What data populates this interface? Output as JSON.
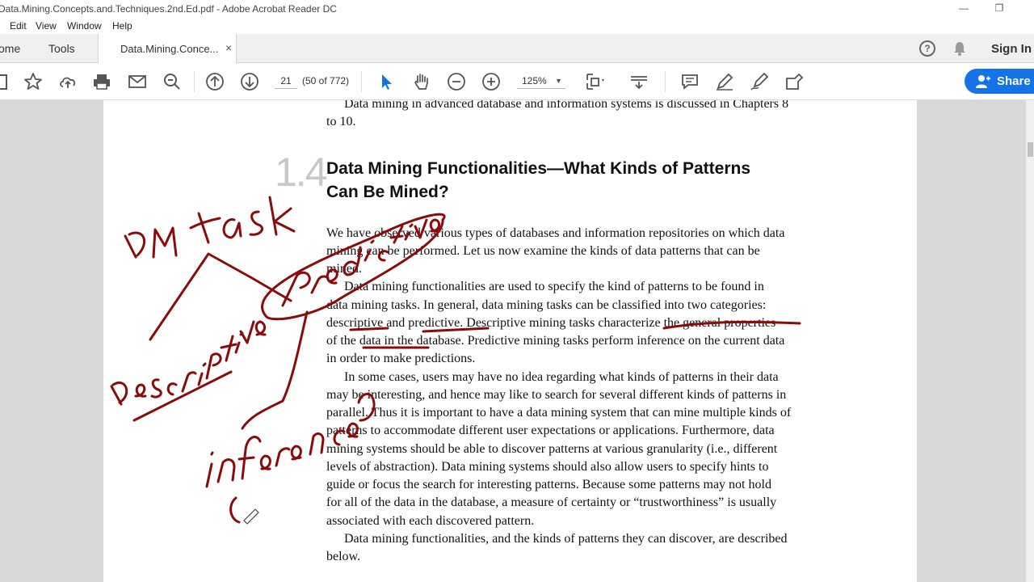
{
  "window": {
    "title": "Data.Mining.Concepts.and.Techniques.2nd.Ed.pdf - Adobe Acrobat Reader DC",
    "minimize": "—",
    "restore": "❐"
  },
  "menu": [
    "Edit",
    "View",
    "Window",
    "Help"
  ],
  "tabs": {
    "home": "ome",
    "tools": "Tools",
    "document": "Data.Mining.Conce...",
    "close": "×",
    "sign_in": "Sign In"
  },
  "toolbar": {
    "page_current": "21",
    "page_of": "(50 of 772)",
    "zoom": "125%",
    "share": "Share"
  },
  "document": {
    "intro_lines": [
      "Data mining in advanced database and information systems is discussed in Chapters 8",
      "to 10."
    ],
    "section_number": "1.4",
    "heading_lines": [
      "Data Mining Functionalities—What Kinds of Patterns",
      "Can Be Mined?"
    ],
    "body_lines": [
      "We have observed various types of databases and information repositories on which data",
      "mining can be performed. Let us now examine the kinds of data patterns that can be",
      "mined.",
      "Data mining functionalities are used to specify the kind of patterns to be found in",
      "data mining tasks. In general, data mining tasks can be classified into two categories:",
      "descriptive and predictive. Descriptive mining tasks characterize the general properties",
      "of the data in the database. Predictive mining tasks perform inference on the current data",
      "in order to make predictions.",
      "In some cases, users may have no idea regarding what kinds of patterns in their data",
      "may be interesting, and hence may like to search for several different kinds of patterns in",
      "parallel. Thus it is important to have a data mining system that can mine multiple kinds of",
      "patterns to accommodate different user expectations or applications. Furthermore, data",
      "mining systems should be able to discover patterns at various granularity (i.e., different",
      "levels of abstraction). Data mining systems should also allow users to specify hints to",
      "guide or focus the search for interesting patterns. Because some patterns may not hold",
      "for all of the data in the database, a measure of certainty or “trustworthiness” is usually",
      "associated with each discovered pattern.",
      "Data mining functionalities, and the kinds of patterns they can discover, are described",
      "below."
    ]
  },
  "annotations": {
    "color": "#8b0a0a",
    "words": [
      "DM task",
      "Predictive",
      "Descriptive",
      "inference"
    ]
  }
}
